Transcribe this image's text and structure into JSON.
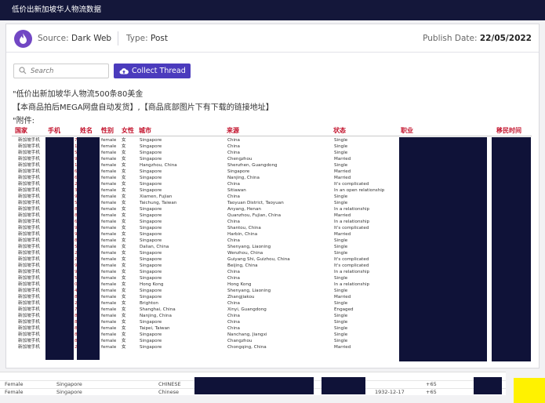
{
  "window": {
    "title": "低价出新加坡华人物流数据"
  },
  "source": {
    "label": "Source:",
    "value": "Dark Web"
  },
  "type": {
    "label": "Type:",
    "value": "Post"
  },
  "publish": {
    "label": "Publish Date:",
    "value": "22/05/2022"
  },
  "search": {
    "placeholder": "Search"
  },
  "collect_button": {
    "label": "Collect Thread"
  },
  "post_lines": [
    "\"低价出新加坡华人物流500条80美金",
    "【本商品拍后MEGA网盘自动发货】,【商品底部图片下有下载的链接地址】",
    "\"附件:"
  ],
  "table": {
    "headers": [
      "国家",
      "手机",
      "姓名",
      "性别",
      "女性",
      "城市",
      "来源",
      "状态",
      "职业",
      "移民时间"
    ],
    "rows": [
      [
        "新加坡手机",
        "7",
        "female",
        "女",
        "Singapore",
        "China",
        "Single"
      ],
      [
        "新加坡手机",
        "1",
        "female",
        "女",
        "Singapore",
        "China",
        "Single"
      ],
      [
        "新加坡手机",
        "5",
        "female",
        "女",
        "Singapore",
        "China",
        "Single"
      ],
      [
        "新加坡手机",
        "9",
        "female",
        "女",
        "Singapore",
        "Chengzhou",
        "Married"
      ],
      [
        "新加坡手机",
        "1",
        "female",
        "女",
        "Hangzhou, China",
        "Shenzhen, Guangdong",
        "Single"
      ],
      [
        "新加坡手机",
        "6",
        "female",
        "女",
        "Singapore",
        "Singapore",
        "Married"
      ],
      [
        "新加坡手机",
        "6",
        "female",
        "女",
        "Singapore",
        "Nanjing, China",
        "Married"
      ],
      [
        "新加坡手机",
        "2",
        "female",
        "女",
        "Singapore",
        "China",
        "It's complicated"
      ],
      [
        "新加坡手机",
        "3",
        "female",
        "女",
        "Singapore",
        "Sitiawan",
        "In an open relationship"
      ],
      [
        "新加坡手机",
        "9",
        "female",
        "女",
        "Xiamen, Fujian",
        "China",
        "Single"
      ],
      [
        "新加坡手机",
        "5",
        "female",
        "女",
        "Taichung, Taiwan",
        "Taoyuan District, Taoyuan",
        "Single"
      ],
      [
        "新加坡手机",
        "8",
        "female",
        "女",
        "Singapore",
        "Anyang, Henan",
        "In a relationship"
      ],
      [
        "新加坡手机",
        "8",
        "female",
        "女",
        "Singapore",
        "Quanzhou, Fujian, China",
        "Married"
      ],
      [
        "新加坡手机",
        "6",
        "female",
        "女",
        "Singapore",
        "China",
        "In a relationship"
      ],
      [
        "新加坡手机",
        "9",
        "female",
        "女",
        "Singapore",
        "Shantou, China",
        "It's complicated"
      ],
      [
        "新加坡手机",
        "9",
        "female",
        "女",
        "Singapore",
        "Harbin, China",
        "Married"
      ],
      [
        "新加坡手机",
        "8",
        "female",
        "女",
        "Singapore",
        "China",
        "Single"
      ],
      [
        "新加坡手机",
        "5",
        "female",
        "女",
        "Dalian, China",
        "Shenyang, Liaoning",
        "Single"
      ],
      [
        "新加坡手机",
        "2",
        "female",
        "女",
        "Singapore",
        "Wenzhou, China",
        "Single"
      ],
      [
        "新加坡手机",
        "2",
        "female",
        "女",
        "Singapore",
        "Guiyang Shi, Guizhou, China",
        "It's complicated"
      ],
      [
        "新加坡手机",
        "9",
        "female",
        "女",
        "Singapore",
        "Beijing, China",
        "It's complicated"
      ],
      [
        "新加坡手机",
        "9",
        "female",
        "女",
        "Singapore",
        "China",
        "In a relationship"
      ],
      [
        "新加坡手机",
        "5",
        "female",
        "女",
        "Singapore",
        "China",
        "Single"
      ],
      [
        "新加坡手机",
        "0",
        "female",
        "女",
        "Hong Kong",
        "Hong Kong",
        "In a relationship"
      ],
      [
        "新加坡手机",
        "4",
        "female",
        "女",
        "Singapore",
        "Shenyang, Liaoning",
        "Single"
      ],
      [
        "新加坡手机",
        "8",
        "female",
        "女",
        "Singapore",
        "Zhangjiakou",
        "Married"
      ],
      [
        "新加坡手机",
        "2",
        "female",
        "女",
        "Brighton",
        "China",
        "Single"
      ],
      [
        "新加坡手机",
        "7",
        "female",
        "女",
        "Shanghai, China",
        "Xinyi, Guangdong",
        "Engaged"
      ],
      [
        "新加坡手机",
        "8",
        "female",
        "女",
        "Nanjing, China",
        "China",
        "Single"
      ],
      [
        "新加坡手机",
        "8",
        "female",
        "女",
        "Singapore",
        "China",
        "Single"
      ],
      [
        "新加坡手机",
        "8",
        "female",
        "女",
        "Taipei, Taiwan",
        "China",
        "Single"
      ],
      [
        "新加坡手机",
        "8",
        "female",
        "女",
        "Singapore",
        "Nanchang, Jiangxi",
        "Single"
      ],
      [
        "新加坡手机",
        "8",
        "female",
        "女",
        "Singapore",
        "Changzhou",
        "Single"
      ],
      [
        "新加坡手机",
        "2",
        "female",
        "女",
        "Singapore",
        "Chongqing, China",
        "Married"
      ]
    ]
  },
  "bottom_rows": [
    {
      "gender": "Female",
      "city": "Singapore",
      "origin": "CHINESE",
      "date": "",
      "code": "+65"
    },
    {
      "gender": "Female",
      "city": "Singapore",
      "origin": "Chinese",
      "date": "1932-12-17",
      "code": "+65"
    }
  ],
  "colors": {
    "header_bg": "#14173a",
    "accent": "#4b3bbd",
    "header_red": "#c2102a",
    "redaction": "#0f1238",
    "marker": "#fff200"
  }
}
